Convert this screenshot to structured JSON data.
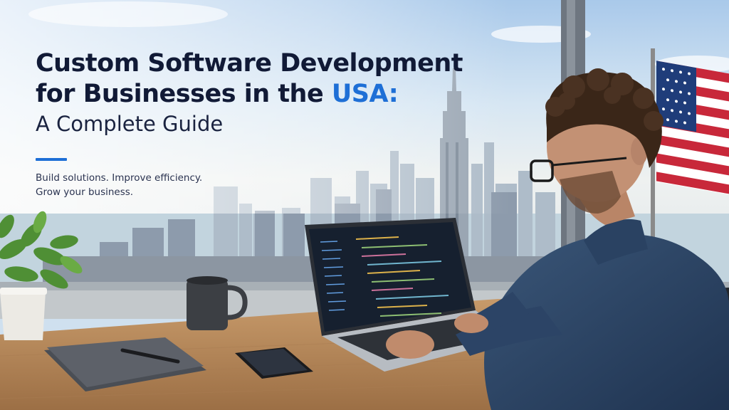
{
  "headline": {
    "line1": "Custom Software Development",
    "line2_prefix": "for Businesses in the ",
    "line2_accent": "USA:",
    "subtitle": "A Complete Guide"
  },
  "tagline": {
    "line1": "Build solutions. Improve efficiency.",
    "line2": "Grow your business."
  },
  "colors": {
    "accent": "#1e6fd6",
    "title": "#111a36"
  }
}
